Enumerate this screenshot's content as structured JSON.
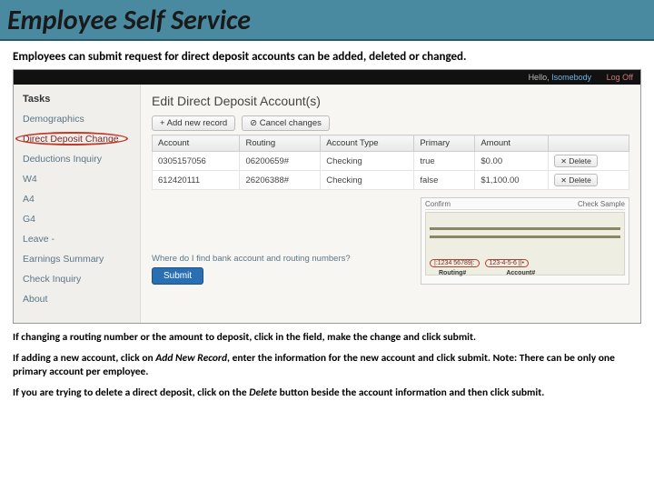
{
  "header": {
    "title": "Employee Self Service"
  },
  "intro": "Employees can submit request for direct deposit accounts can be added, deleted or changed.",
  "app": {
    "topbar": {
      "hello": "Hello,",
      "user": "Isomebody",
      "logoff": "Log Off"
    },
    "sidebar": {
      "title": "Tasks",
      "items": [
        {
          "label": "Demographics"
        },
        {
          "label": "Direct Deposit Change"
        },
        {
          "label": "Deductions Inquiry"
        },
        {
          "label": "W4"
        },
        {
          "label": "A4"
        },
        {
          "label": "G4"
        },
        {
          "label": "Leave -"
        },
        {
          "label": "Earnings Summary"
        },
        {
          "label": "Check Inquiry"
        },
        {
          "label": "About"
        }
      ]
    },
    "main": {
      "title": "Edit Direct Deposit Account(s)",
      "toolbar": {
        "add": "+ Add new record",
        "cancel": "⊘ Cancel changes"
      },
      "columns": [
        "Account",
        "Routing",
        "Account Type",
        "Primary",
        "Amount",
        ""
      ],
      "rows": [
        {
          "account": "0305157056",
          "routing": "06200659#",
          "type": "Checking",
          "primary": "true",
          "amount": "$0.00",
          "del": "Delete"
        },
        {
          "account": "612420111",
          "routing": "26206388#",
          "type": "Checking",
          "primary": "false",
          "amount": "$1,100.00",
          "del": "Delete"
        }
      ],
      "help": "Where do I find bank account and routing numbers?",
      "submit": "Submit",
      "check": {
        "tab_confirm": "Confirm",
        "tab_sample": "Check Sample",
        "routing_seg": "|:1234 56789|:",
        "account_seg": "123-4-5-6 ||•",
        "routing_label": "Routing#",
        "account_label": "Account#"
      }
    }
  },
  "notes": {
    "p1": "If changing a routing number or the amount to deposit, click in the field, make the change and click submit.",
    "p2a": "If adding a new account, click on ",
    "p2b": "Add New Record",
    "p2c": ", enter the information for the new account and click submit.  Note:   There can be only one primary account per employee.",
    "p3a": "If you are trying to delete a direct deposit, click on the ",
    "p3b": "Delete",
    "p3c": " button beside the account information and then click submit."
  }
}
